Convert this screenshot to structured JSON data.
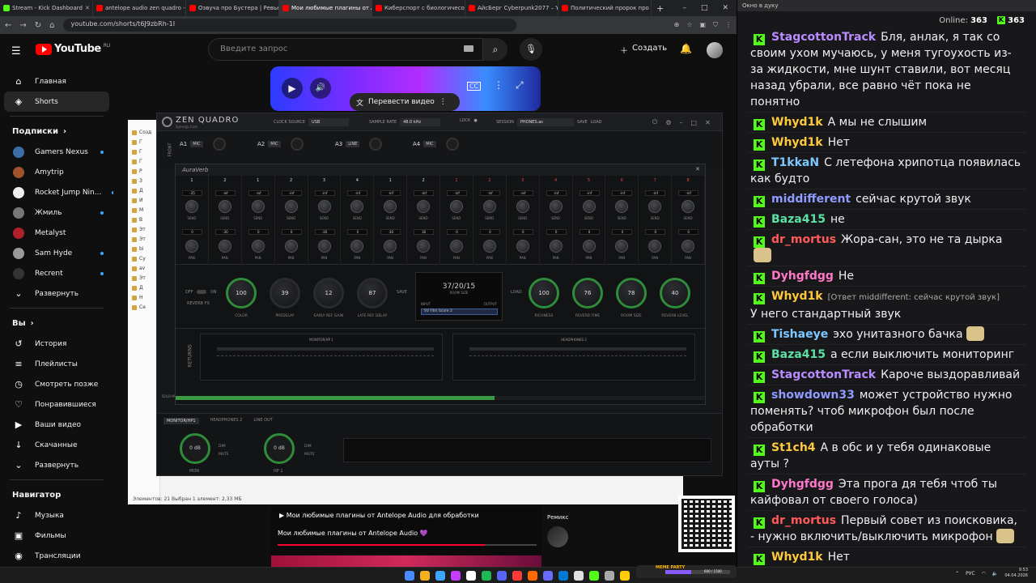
{
  "browser": {
    "tabs": [
      {
        "title": "Stream - Kick Dashboard",
        "color": "#53fc18",
        "active": false
      },
      {
        "title": "antelope audio zen quadro - Y",
        "color": "#ff0000",
        "active": false
      },
      {
        "title": "Озвуча про Бустера | Ревью",
        "color": "#ff0000",
        "active": false
      },
      {
        "title": "Мои любимые плагины от Ant",
        "color": "#ff0000",
        "active": true
      },
      {
        "title": "Киберспорт с биологичесо",
        "color": "#ff0000",
        "active": false
      },
      {
        "title": "АйсБерг Cyberpunk2077 – Y",
        "color": "#ff0000",
        "active": false
      },
      {
        "title": "Политический пророк про",
        "color": "#ff0000",
        "active": false
      }
    ],
    "new_tab": "+",
    "url": "youtube.com/shorts/t6J9zbRh-1I"
  },
  "youtube": {
    "logo": "YouTube",
    "region": "RU",
    "search_placeholder": "Введите запрос",
    "create_label": "Создать",
    "sidebar_main": [
      {
        "label": "Главная",
        "icon": "home-icon",
        "glyph": "⌂"
      },
      {
        "label": "Shorts",
        "icon": "shorts-icon",
        "glyph": "◈",
        "active": true
      }
    ],
    "subs_header": "Подписки",
    "channels": [
      {
        "label": "Gamers Nexus",
        "color": "#3a6ea5",
        "dot": true
      },
      {
        "label": "Amytrip",
        "color": "#a0522d",
        "dot": false
      },
      {
        "label": "Rocket Jump Nin...",
        "color": "#eeeeee",
        "dot": true
      },
      {
        "label": "Жмиль",
        "color": "#777777",
        "dot": true
      },
      {
        "label": "Metalyst",
        "color": "#b0202a",
        "dot": false
      },
      {
        "label": "Sam Hyde",
        "color": "#999999",
        "dot": true
      },
      {
        "label": "Recrent",
        "color": "#333333",
        "dot": true
      }
    ],
    "expand_label": "Развернуть",
    "you_header": "Вы",
    "you_items": [
      {
        "label": "История",
        "glyph": "↺"
      },
      {
        "label": "Плейлисты",
        "glyph": "≡"
      },
      {
        "label": "Смотреть позже",
        "glyph": "◷"
      },
      {
        "label": "Понравившиеся",
        "glyph": "♡"
      },
      {
        "label": "Ваши видео",
        "glyph": "▶"
      },
      {
        "label": "Скачанные",
        "glyph": "↓"
      },
      {
        "label": "Развернуть",
        "glyph": "⌄"
      }
    ],
    "nav_header": "Навигатор",
    "nav_items": [
      {
        "label": "Музыка",
        "glyph": "♪"
      },
      {
        "label": "Фильмы",
        "glyph": "▣"
      },
      {
        "label": "Трансляции",
        "glyph": "◉"
      }
    ],
    "translate_label": "Перевести видео",
    "video_title_1": "Мои любимые плагины от Antelope Audio для обработки",
    "video_title_2": "Мои любимые плагины от Antelope Audio 💜",
    "remix_label": "Ремикс",
    "video_progress": 0.8
  },
  "explorer": {
    "rows": [
      "Созд",
      "Г",
      "Г",
      "Г",
      "Р",
      "З",
      "Д",
      "И",
      "М",
      "В",
      "Эт",
      "Эт",
      "bi",
      "Cy",
      "av",
      "Эт",
      "Д",
      "Н",
      "Се"
    ],
    "status": "Элементов: 21    Выбран 1 элемент: 2,33 МБ"
  },
  "zen": {
    "logo": "ZEN QUADRO",
    "logo_sub": "Synergy Core",
    "clock_label": "CLOCK SOURCE",
    "clock_value": "USB",
    "rate_label": "SAMPLE RATE",
    "rate_value": "48.0 kHz",
    "lock_label": "LOCK",
    "session_label": "SESSION",
    "session_value": "PHONES.as",
    "save_label": "SAVE",
    "load_label": "LOAD",
    "front_label": "FRONT",
    "inputs": [
      {
        "name": "A1",
        "type": "MIC"
      },
      {
        "name": "A2",
        "type": "MIC"
      },
      {
        "name": "A3",
        "type": "LINE"
      },
      {
        "name": "A4",
        "type": "MIC"
      }
    ],
    "strip": [
      "SOLO  MUTE  LINK",
      "SOLO  MUTE  LINK",
      "SOLO  MUTE  LINK",
      "SOLO  MUTE  LINK",
      "SOLO  MUTE  LINK",
      "SOLO  MUTE  LINK",
      "SOLO  MUTE  LINK",
      "SOLO  MUTE  LINK",
      "SOLO  MUTE  LINK",
      "SOLO  MUTE  LINK"
    ],
    "bottom_tabs": [
      "MONITOR/HP1",
      "HEADPHONES 2",
      "LINE OUT"
    ],
    "mon_value": "0 dB",
    "mon_label": "MON",
    "hp_value": "0 dB",
    "hp_label": "HP 1",
    "dim_label": "DIM",
    "mute_label": "MUTE"
  },
  "aura": {
    "title": "AuraVerb",
    "columns": [
      {
        "num": "1",
        "v1": "-35",
        "v2": "0"
      },
      {
        "num": "2",
        "v1": "-inf",
        "v2": "-30"
      },
      {
        "num": "1",
        "v1": "-inf",
        "v2": "0"
      },
      {
        "num": "2",
        "v1": "-inf",
        "v2": "0"
      },
      {
        "num": "3",
        "v1": "-inf",
        "v2": "-30"
      },
      {
        "num": "4",
        "v1": "-inf",
        "v2": "0"
      },
      {
        "num": "1",
        "v1": "-inf",
        "v2": "-30"
      },
      {
        "num": "2",
        "v1": "-inf",
        "v2": "30"
      },
      {
        "num": "1",
        "v1": "-inf",
        "v2": "0"
      },
      {
        "num": "2",
        "v1": "-inf",
        "v2": "0"
      },
      {
        "num": "3",
        "v1": "-inf",
        "v2": "0"
      },
      {
        "num": "4",
        "v1": "-inf",
        "v2": "0"
      },
      {
        "num": "5",
        "v1": "-inf",
        "v2": "0"
      },
      {
        "num": "6",
        "v1": "-inf",
        "v2": "0"
      },
      {
        "num": "7",
        "v1": "-inf",
        "v2": "0"
      },
      {
        "num": "8",
        "v1": "-inf",
        "v2": "0"
      }
    ],
    "send_label": "SEND",
    "pan_label": "PAN",
    "reverb_fx_label": "REVERB FX",
    "off_label": "OFF",
    "on_label": "ON",
    "save_label": "SAVE",
    "load_label": "LOAD",
    "knobs_left": [
      {
        "value": "100",
        "label": "COLOR",
        "green": true
      },
      {
        "value": "39",
        "label": "PREDELAY",
        "green": false
      },
      {
        "value": "12",
        "label": "EARLY REF GAIN",
        "green": false
      },
      {
        "value": "87",
        "label": "LATE REF DELAY",
        "green": false
      }
    ],
    "knobs_right": [
      {
        "value": "100",
        "label": "RICHNESS",
        "green": true
      },
      {
        "value": "76",
        "label": "REVERB TIME",
        "green": true
      },
      {
        "value": "78",
        "label": "ROOM SIZE",
        "green": true
      },
      {
        "value": "40",
        "label": "REVERB LEVEL",
        "green": true
      }
    ],
    "room_value": "37/20/15",
    "room_label": "ROOM SIZE",
    "input_label": "INPUT",
    "output_label": "OUTPUT",
    "preset": "SV Film Score 2",
    "returns_label": "RETURNS",
    "return_buses": [
      "MONITOR/HP 1",
      "HEADPHONES 2"
    ],
    "scroll_position": 0.6
  },
  "chat": {
    "window_title": "Окно в дуку",
    "online_label": "Online:",
    "online_count": "363",
    "k_count": "363",
    "messages": [
      {
        "user": "StagcottonTrack",
        "color": "#b98cff",
        "text": "Бля, анлак, я так со своим ухом мучаюсь, у меня тугоухость из-за жидкости, мне шунт ставили, вот месяц назад убрали, все равно чёт пока не понятно"
      },
      {
        "user": "Whyd1k",
        "color": "#ffc93c",
        "text": "А мы не слышим"
      },
      {
        "user": "Whyd1k",
        "color": "#ffc93c",
        "text": "Нет"
      },
      {
        "user": "T1kkaN",
        "color": "#7ec8ff",
        "text": "С летефона хрипотца появилась как будто"
      },
      {
        "user": "middifferent",
        "color": "#8f9bff",
        "text": "сейчас крутой звук"
      },
      {
        "user": "Baza415",
        "color": "#5ce0a4",
        "text": "не"
      },
      {
        "user": "dr_mortus",
        "color": "#ff5a5a",
        "text": "Жора-сан, это не та дырка",
        "emote": true
      },
      {
        "user": "Dyhgfdgg",
        "color": "#ff77c8",
        "text": "Не"
      },
      {
        "user": "Whyd1k",
        "color": "#ffc93c",
        "reply": "[Ответ middifferent: сейчас крутой звук]",
        "text": "У него стандартный звук"
      },
      {
        "user": "Tishaeye",
        "color": "#7ec8ff",
        "text": "эхо унитазного бачка",
        "emote": true
      },
      {
        "user": "Baza415",
        "color": "#5ce0a4",
        "text": "а если выключить мониторинг"
      },
      {
        "user": "StagcottonTrack",
        "color": "#b98cff",
        "text": "Кароче выздоравливай"
      },
      {
        "user": "showdown33",
        "color": "#8f9bff",
        "text": "может устройство нужно поменять? чтоб микрофон был после обработки"
      },
      {
        "user": "St1ch4",
        "color": "#ffc93c",
        "text": "А в обс и у тебя одинаковые ауты ?"
      },
      {
        "user": "Dyhgfdgg",
        "color": "#ff77c8",
        "text": "Эта прога дя тебя чтоб ты кайфовал от своего голоса)"
      },
      {
        "user": "dr_mortus",
        "color": "#ff5a5a",
        "text": "Первый совет из поисковика, - нужно включить/выключить микрофон",
        "emote": true
      },
      {
        "user": "Whyd1k",
        "color": "#ffc93c",
        "text": "Нет"
      }
    ]
  },
  "taskbar": {
    "meme_label": "MEME PARTY",
    "meme_count": "600 / 1500",
    "meme_progress": 0.4,
    "lang": "РУС",
    "time": "9:53",
    "date": "04.04.2026",
    "app_colors": [
      "#4a8cff",
      "#f2b01e",
      "#3ea6ff",
      "#c43cff",
      "#ffffff",
      "#1db954",
      "#5865f2",
      "#ff3a3a",
      "#ff6a00",
      "#6a6aff",
      "#0078d4",
      "#e0e0e0",
      "#53fc18",
      "#aaaaaa",
      "#ffcc00"
    ]
  }
}
